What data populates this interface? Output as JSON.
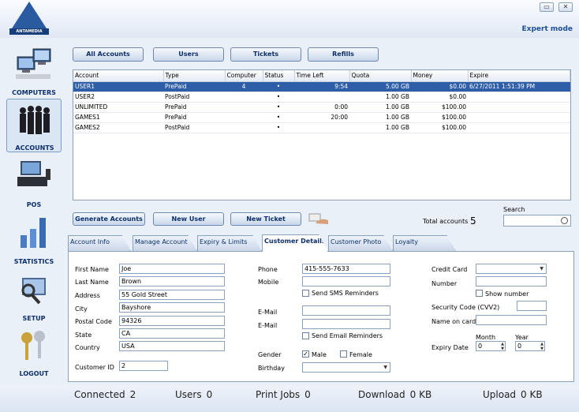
{
  "app": {
    "logo_text": "ANTAMEDIA",
    "mode_label": "Expert mode",
    "minimize": "▭",
    "close": "✕"
  },
  "sidebar": [
    {
      "label": "COMPUTERS",
      "icon": "computers-icon"
    },
    {
      "label": "ACCOUNTS",
      "icon": "accounts-icon"
    },
    {
      "label": "POS",
      "icon": "pos-icon"
    },
    {
      "label": "STATISTICS",
      "icon": "statistics-icon"
    },
    {
      "label": "SETUP",
      "icon": "setup-icon"
    },
    {
      "label": "LOGOUT",
      "icon": "logout-icon"
    }
  ],
  "top_buttons": [
    "All Accounts",
    "Users",
    "Tickets",
    "Refills"
  ],
  "grid": {
    "columns": [
      "Account",
      "Type",
      "Computer",
      "Status",
      "Time Left",
      "Quota",
      "Money",
      "Expire"
    ],
    "rows": [
      [
        "USER1",
        "PrePaid",
        "4",
        "•",
        "9:54",
        "5.00 GB",
        "$0.00",
        "6/27/2011 1:51:39 PM"
      ],
      [
        "USER2",
        "PostPaid",
        "",
        "•",
        "",
        "1.00 GB",
        "$0.00",
        ""
      ],
      [
        "UNLIMITED",
        "PrePaid",
        "",
        "•",
        "0:00",
        "1.00 GB",
        "$100.00",
        ""
      ],
      [
        "GAMES1",
        "PrePaid",
        "",
        "•",
        "20:00",
        "1.00 GB",
        "$100.00",
        ""
      ],
      [
        "GAMES2",
        "PostPaid",
        "",
        "•",
        "",
        "1.00 GB",
        "$100.00",
        ""
      ]
    ]
  },
  "mid_buttons": {
    "generate": "Generate Accounts",
    "new_user": "New User",
    "new_ticket": "New Ticket"
  },
  "totals": {
    "label": "Total accounts",
    "value": "5"
  },
  "search": {
    "label": "Search",
    "value": ""
  },
  "tabs": [
    "Account Info",
    "Manage Account",
    "Expiry & Limits",
    "Customer Details",
    "Customer Photo",
    "Loyalty"
  ],
  "form": {
    "first_name_label": "First Name",
    "first_name": "Joe",
    "last_name_label": "Last Name",
    "last_name": "Brown",
    "address_label": "Address",
    "address": "55 Gold Street",
    "city_label": "City",
    "city": "Bayshore",
    "postal_label": "Postal Code",
    "postal": "94326",
    "state_label": "State",
    "state": "CA",
    "country_label": "Country",
    "country": "USA",
    "customer_id_label": "Customer ID",
    "customer_id": "2",
    "phone_label": "Phone",
    "phone": "415-555-7633",
    "mobile_label": "Mobile",
    "mobile": "",
    "sms_label": "Send SMS Reminders",
    "email_label": "E-Mail",
    "email2_label": "E-Mail",
    "email_reminder_label": "Send Email Reminders",
    "gender_label": "Gender",
    "male": "Male",
    "female": "Female",
    "birthday_label": "Birthday",
    "credit_card_label": "Credit Card",
    "number_label": "Number",
    "show_number_label": "Show number",
    "cvv_label": "Security Code (CVV2)",
    "name_on_card_label": "Name on card",
    "expiry_label": "Expiry Date",
    "month_label": "Month",
    "year_label": "Year",
    "month": "0",
    "year": "0"
  },
  "status": {
    "connected_label": "Connected",
    "connected": "2",
    "users_label": "Users",
    "users": "0",
    "print_label": "Print Jobs",
    "print": "0",
    "download_label": "Download",
    "download": "0 KB",
    "upload_label": "Upload",
    "upload": "0 KB"
  }
}
